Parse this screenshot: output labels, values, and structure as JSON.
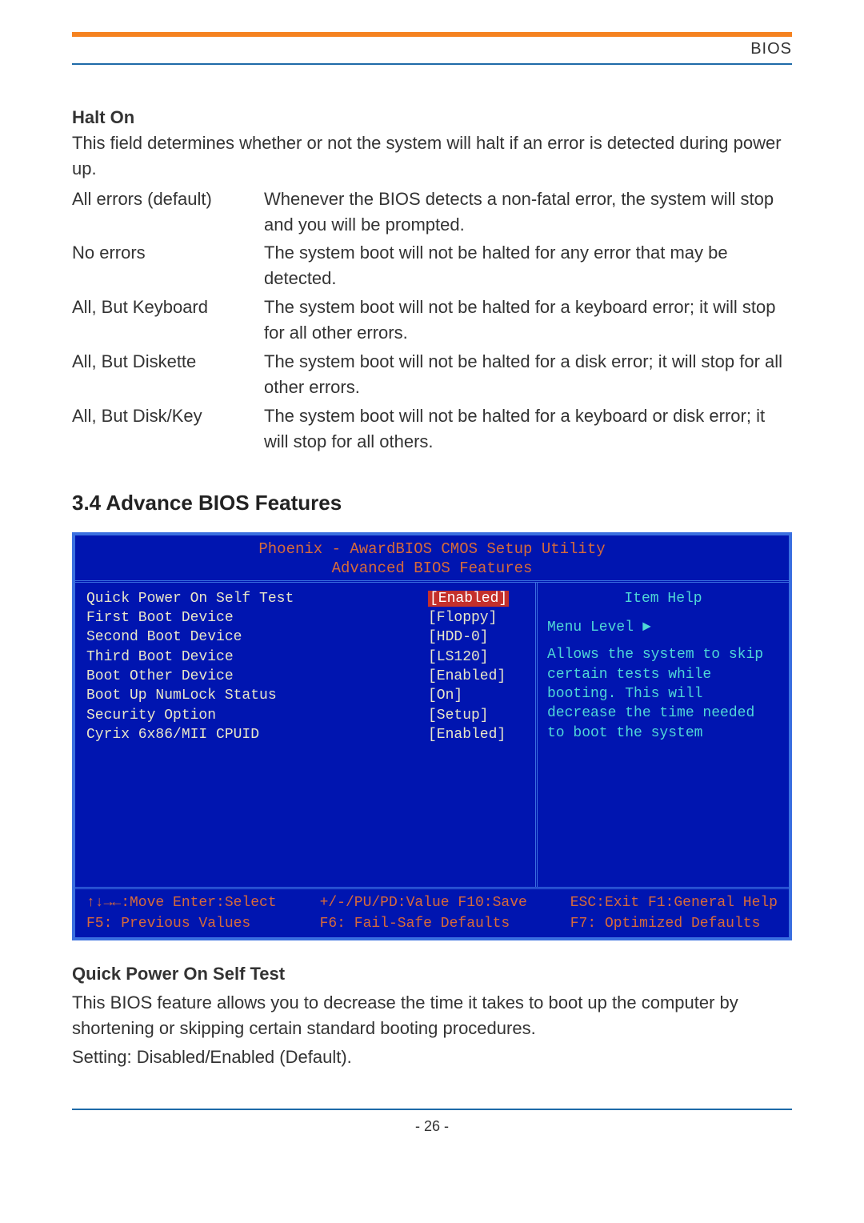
{
  "header": {
    "bios": "BIOS"
  },
  "halt": {
    "title": "Halt On",
    "intro": "This field determines whether or not the system will halt if an error is detected during power up.",
    "rows": [
      {
        "label": "All errors (default)",
        "desc": " Whenever the BIOS detects a non-fatal error, the system will stop and you will be prompted."
      },
      {
        "label": "No errors",
        "desc": " The system boot will not be halted for any error that may be detected."
      },
      {
        "label": "All, But Keyboard",
        "desc": " The system boot will not be halted for a keyboard error; it will stop for all other errors."
      },
      {
        "label": "All, But Diskette",
        "desc": "The system boot will not be halted for a disk error; it will stop for all other errors."
      },
      {
        "label": "All, But Disk/Key",
        "desc": " The system boot will not be halted for a keyboard or disk error; it will stop for all others."
      }
    ]
  },
  "section34": "3.4 Advance BIOS Features",
  "bios": {
    "title1": "Phoenix - AwardBIOS CMOS Setup Utility",
    "title2": "Advanced BIOS Features",
    "items": [
      {
        "label": "Quick Power On Self Test",
        "value": "[Enabled]",
        "hl": true
      },
      {
        "label": "First Boot Device",
        "value": "[Floppy]"
      },
      {
        "label": "Second Boot Device",
        "value": "[HDD-0]"
      },
      {
        "label": "Third Boot Device",
        "value": "[LS120]"
      },
      {
        "label": "Boot Other Device",
        "value": "[Enabled]"
      },
      {
        "label": "Boot Up NumLock Status",
        "value": "[On]"
      },
      {
        "label": "Security Option",
        "value": "[Setup]"
      },
      {
        "label": "Cyrix 6x86/MII CPUID",
        "value": "[Enabled]"
      }
    ],
    "help_title": "Item Help",
    "menu_level": "Menu Level   ►",
    "help_text": "Allows the system to skip certain tests while booting. This will decrease the time needed to boot the system",
    "footer": {
      "l1a": "↑↓→←:Move  Enter:Select",
      "l1b": "+/-/PU/PD:Value  F10:Save",
      "l1c": "ESC:Exit  F1:General Help",
      "l2a": "F5: Previous Values",
      "l2b": "F6: Fail-Safe Defaults",
      "l2c": "F7: Optimized Defaults"
    }
  },
  "qpost": {
    "title": "Quick Power On Self Test",
    "p1": "This BIOS feature allows you to decrease the time it takes to boot up the computer by shortening or skipping certain standard booting procedures.",
    "p2": "Setting: Disabled/Enabled (Default)."
  },
  "pagenum": "- 26 -"
}
